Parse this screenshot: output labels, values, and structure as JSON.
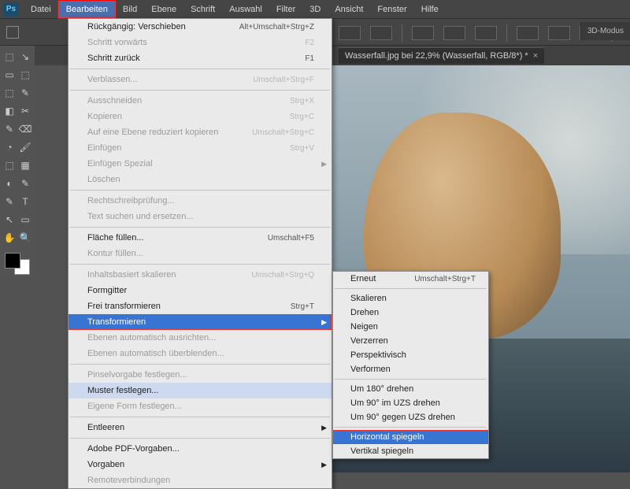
{
  "app": {
    "logo_text": "Ps"
  },
  "menubar": {
    "items": [
      {
        "label": "Datei"
      },
      {
        "label": "Bearbeiten",
        "active": true
      },
      {
        "label": "Bild"
      },
      {
        "label": "Ebene"
      },
      {
        "label": "Schrift"
      },
      {
        "label": "Auswahl"
      },
      {
        "label": "Filter"
      },
      {
        "label": "3D"
      },
      {
        "label": "Ansicht"
      },
      {
        "label": "Fenster"
      },
      {
        "label": "Hilfe"
      }
    ]
  },
  "rightlabel": "3D-Modus",
  "doctab": {
    "title": "Wasserfall.jpg bei 22,9% (Wasserfall, RGB/8*) *",
    "close": "×"
  },
  "edit_menu": {
    "items": [
      {
        "label": "Rückgängig: Verschieben",
        "shortcut": "Alt+Umschalt+Strg+Z"
      },
      {
        "label": "Schritt vorwärts",
        "shortcut": "F2",
        "disabled": true
      },
      {
        "label": "Schritt zurück",
        "shortcut": "F1"
      },
      {
        "sep": true
      },
      {
        "label": "Verblassen...",
        "shortcut": "Umschalt+Strg+F",
        "disabled": true
      },
      {
        "sep": true
      },
      {
        "label": "Ausschneiden",
        "shortcut": "Strg+X",
        "disabled": true
      },
      {
        "label": "Kopieren",
        "shortcut": "Strg+C",
        "disabled": true
      },
      {
        "label": "Auf eine Ebene reduziert kopieren",
        "shortcut": "Umschalt+Strg+C",
        "disabled": true
      },
      {
        "label": "Einfügen",
        "shortcut": "Strg+V",
        "disabled": true
      },
      {
        "label": "Einfügen Spezial",
        "submenu": true,
        "disabled": true
      },
      {
        "label": "Löschen",
        "disabled": true
      },
      {
        "sep": true
      },
      {
        "label": "Rechtschreibprüfung...",
        "disabled": true
      },
      {
        "label": "Text suchen und ersetzen...",
        "disabled": true
      },
      {
        "sep": true
      },
      {
        "label": "Fläche füllen...",
        "shortcut": "Umschalt+F5"
      },
      {
        "label": "Kontur füllen...",
        "disabled": true
      },
      {
        "sep": true
      },
      {
        "label": "Inhaltsbasiert skalieren",
        "shortcut": "Umschalt+Strg+Q",
        "disabled": true
      },
      {
        "label": "Formgitter"
      },
      {
        "label": "Frei transformieren",
        "shortcut": "Strg+T"
      },
      {
        "label": "Transformieren",
        "submenu": true,
        "selected": true
      },
      {
        "label": "Ebenen automatisch ausrichten...",
        "disabled": true
      },
      {
        "label": "Ebenen automatisch überblenden...",
        "disabled": true
      },
      {
        "sep": true
      },
      {
        "label": "Pinselvorgabe festlegen...",
        "disabled": true
      },
      {
        "label": "Muster festlegen...",
        "hov": true
      },
      {
        "label": "Eigene Form festlegen...",
        "disabled": true
      },
      {
        "sep": true
      },
      {
        "label": "Entleeren",
        "submenu": true
      },
      {
        "sep": true
      },
      {
        "label": "Adobe PDF-Vorgaben..."
      },
      {
        "label": "Vorgaben",
        "submenu": true
      },
      {
        "label": "Remoteverbindungen",
        "disabled": true
      }
    ]
  },
  "transform_submenu": {
    "items": [
      {
        "label": "Erneut",
        "shortcut": "Umschalt+Strg+T"
      },
      {
        "sep": true
      },
      {
        "label": "Skalieren"
      },
      {
        "label": "Drehen"
      },
      {
        "label": "Neigen"
      },
      {
        "label": "Verzerren"
      },
      {
        "label": "Perspektivisch"
      },
      {
        "label": "Verformen"
      },
      {
        "sep": true
      },
      {
        "label": "Um 180° drehen"
      },
      {
        "label": "Um 90° im UZS drehen"
      },
      {
        "label": "Um 90° gegen UZS drehen"
      },
      {
        "sep": true
      },
      {
        "label": "Horizontal spiegeln",
        "selected": true
      },
      {
        "label": "Vertikal spiegeln"
      }
    ]
  },
  "tools": {
    "rows": [
      [
        "⬚",
        "↘"
      ],
      [
        "▭",
        "⬚"
      ],
      [
        "⬚",
        "✎"
      ],
      [
        "◧",
        "✂"
      ],
      [
        "✎",
        "⌫"
      ],
      [
        "◔",
        "🖌"
      ],
      [
        "⬚",
        "▦"
      ],
      [
        "◐",
        "✎"
      ],
      [
        "✎",
        "T"
      ],
      [
        "↖",
        "▭"
      ],
      [
        "✋",
        "🔍"
      ]
    ]
  }
}
